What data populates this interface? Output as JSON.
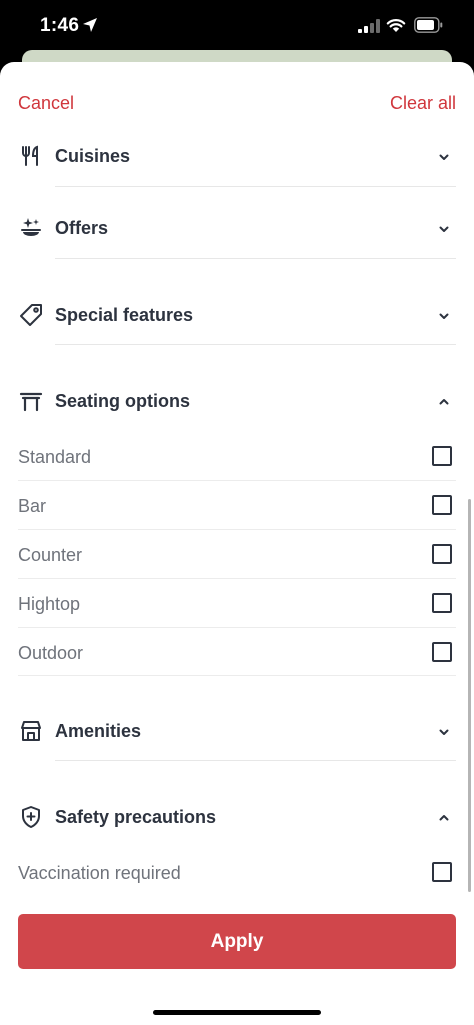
{
  "status_bar": {
    "time": "1:46"
  },
  "header": {
    "cancel_label": "Cancel",
    "clear_label": "Clear all"
  },
  "sections": {
    "cuisines": {
      "label": "Cuisines",
      "icon": "utensils-icon",
      "expanded": false
    },
    "offers": {
      "label": "Offers",
      "icon": "sparkle-dish-icon",
      "expanded": false
    },
    "special_features": {
      "label": "Special features",
      "icon": "tag-icon",
      "expanded": false
    },
    "seating": {
      "label": "Seating options",
      "icon": "table-icon",
      "expanded": true,
      "options": [
        {
          "label": "Standard",
          "checked": false
        },
        {
          "label": "Bar",
          "checked": false
        },
        {
          "label": "Counter",
          "checked": false
        },
        {
          "label": "Hightop",
          "checked": false
        },
        {
          "label": "Outdoor",
          "checked": false
        }
      ]
    },
    "amenities": {
      "label": "Amenities",
      "icon": "storefront-icon",
      "expanded": false
    },
    "safety": {
      "label": "Safety precautions",
      "icon": "shield-plus-icon",
      "expanded": true,
      "options": [
        {
          "label": "Vaccination required",
          "checked": false
        }
      ]
    }
  },
  "apply_label": "Apply",
  "colors": {
    "accent": "#d0363c",
    "apply_bg": "#d0464b",
    "text_dark": "#2d333f",
    "text_muted": "#6f737b"
  }
}
